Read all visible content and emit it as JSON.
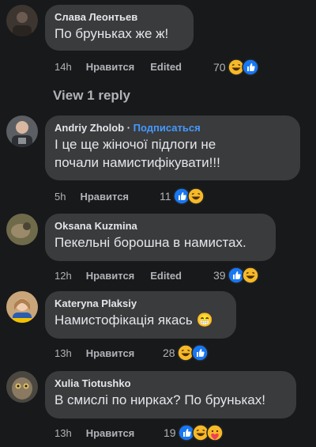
{
  "comments": [
    {
      "author": "Слава Леонтьев",
      "follow": "",
      "text": [
        "По бруньках же ж!"
      ],
      "time": "14h",
      "like": "Нравится",
      "edited": "Edited",
      "reaction_count": "70",
      "reactions": [
        "haha-icon",
        "like-icon"
      ]
    },
    {
      "author": "Andriy Zholob",
      "follow": "Подписаться",
      "text": [
        "І це ще жіночої підлоги не",
        "почали намистифікувати!!!"
      ],
      "time": "5h",
      "like": "Нравится",
      "edited": "",
      "reaction_count": "11",
      "reactions": [
        "like-icon",
        "haha-icon"
      ]
    },
    {
      "author": "Oksana Kuzmina",
      "follow": "",
      "text": [
        "Пекельні борошна в намистах."
      ],
      "time": "12h",
      "like": "Нравится",
      "edited": "Edited",
      "reaction_count": "39",
      "reactions": [
        "like-icon",
        "haha-icon"
      ]
    },
    {
      "author": "Kateryna Plaksiy",
      "follow": "",
      "text": [
        "Намистофікація якась 😁"
      ],
      "time": "13h",
      "like": "Нравится",
      "edited": "",
      "reaction_count": "28",
      "reactions": [
        "haha-icon",
        "like-icon"
      ]
    },
    {
      "author": "Xulia Tiotushko",
      "follow": "",
      "text": [
        "В смислі по нирках? По бруньках!"
      ],
      "time": "13h",
      "like": "Нравится",
      "edited": "",
      "reaction_count": "19",
      "reactions": [
        "like-icon",
        "haha-icon",
        "care-icon"
      ]
    }
  ],
  "view_reply": "View 1 reply",
  "colors": {
    "background": "#18191a",
    "bubble": "#3a3b3c",
    "text": "#e4e6eb",
    "muted": "#b0b3b8",
    "follow": "#4599ff",
    "like_blue": "#1877f2",
    "haha_yellow": "#f7b928"
  }
}
